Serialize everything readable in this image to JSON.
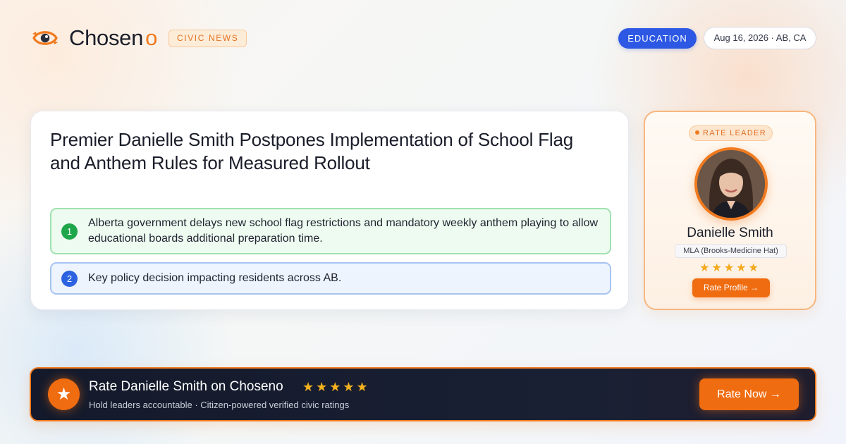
{
  "brand": {
    "name": "Chosen",
    "name_accent": "o",
    "section_badge": "CIVIC NEWS",
    "accent_color": "#f07a1f"
  },
  "header": {
    "category": "EDUCATION",
    "date_location": "Aug 16, 2026 · AB, CA"
  },
  "article": {
    "headline": "Premier Danielle Smith Postpones Implementation of School Flag and Anthem Rules for Measured Rollout",
    "points": [
      {
        "number": "1",
        "text": "Alberta government delays new school flag restrictions and mandatory weekly anthem playing to allow educational boards additional preparation time."
      },
      {
        "number": "2",
        "text": "Key policy decision impacting residents across AB."
      }
    ]
  },
  "leader": {
    "badge": "RATE LEADER",
    "name": "Danielle Smith",
    "role": "MLA (Brooks-Medicine Hat)",
    "stars": "★★★★★",
    "rating_stars": 5,
    "button": "Rate Profile →"
  },
  "banner": {
    "icon": "star-icon",
    "title": "Rate Danielle Smith on Choseno",
    "stars": "★★★★★",
    "subtitle": "Hold leaders accountable · Citizen-powered verified civic ratings",
    "button": "Rate Now →"
  }
}
